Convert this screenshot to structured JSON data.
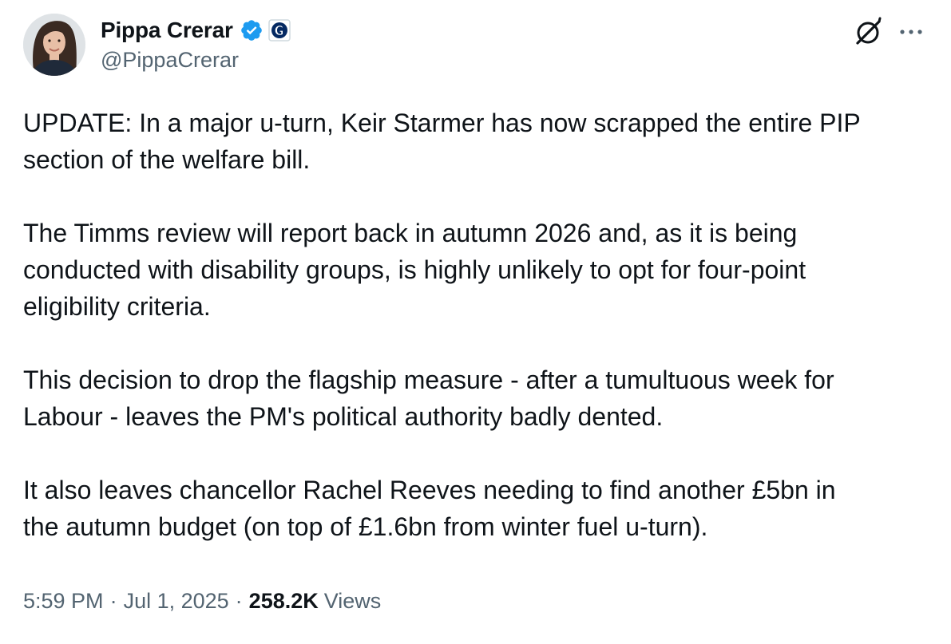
{
  "author": {
    "display_name": "Pippa Crerar",
    "handle": "@PippaCrerar",
    "verified": true,
    "affiliation_badge": "guardian-badge-icon",
    "avatar": "avatar-photo"
  },
  "actions": {
    "grok_icon": "grok-icon",
    "more_icon": "more-options-icon"
  },
  "tweet": {
    "paragraphs": [
      "UPDATE: In a major u-turn, Keir Starmer has now scrapped the entire PIP\nsection of the welfare bill.",
      "The Timms review will report back in autumn 2026 and, as it is being\nconducted with disability groups, is highly unlikely to opt for four-point\neligibility criteria.",
      "This decision to drop the flagship measure - after a tumultuous week for\nLabour - leaves the PM's political authority badly dented.",
      "It also leaves chancellor Rachel Reeves needing to find another £5bn in\nthe autumn budget (on top of £1.6bn from winter fuel u-turn)."
    ],
    "time": "5:59 PM",
    "date": "Jul 1, 2025",
    "separator": "·",
    "views_count": "258.2K",
    "views_label": "Views"
  },
  "colors": {
    "text_primary": "#0f1419",
    "text_secondary": "#536471",
    "verified_blue": "#1d9bf0",
    "background": "#ffffff"
  }
}
